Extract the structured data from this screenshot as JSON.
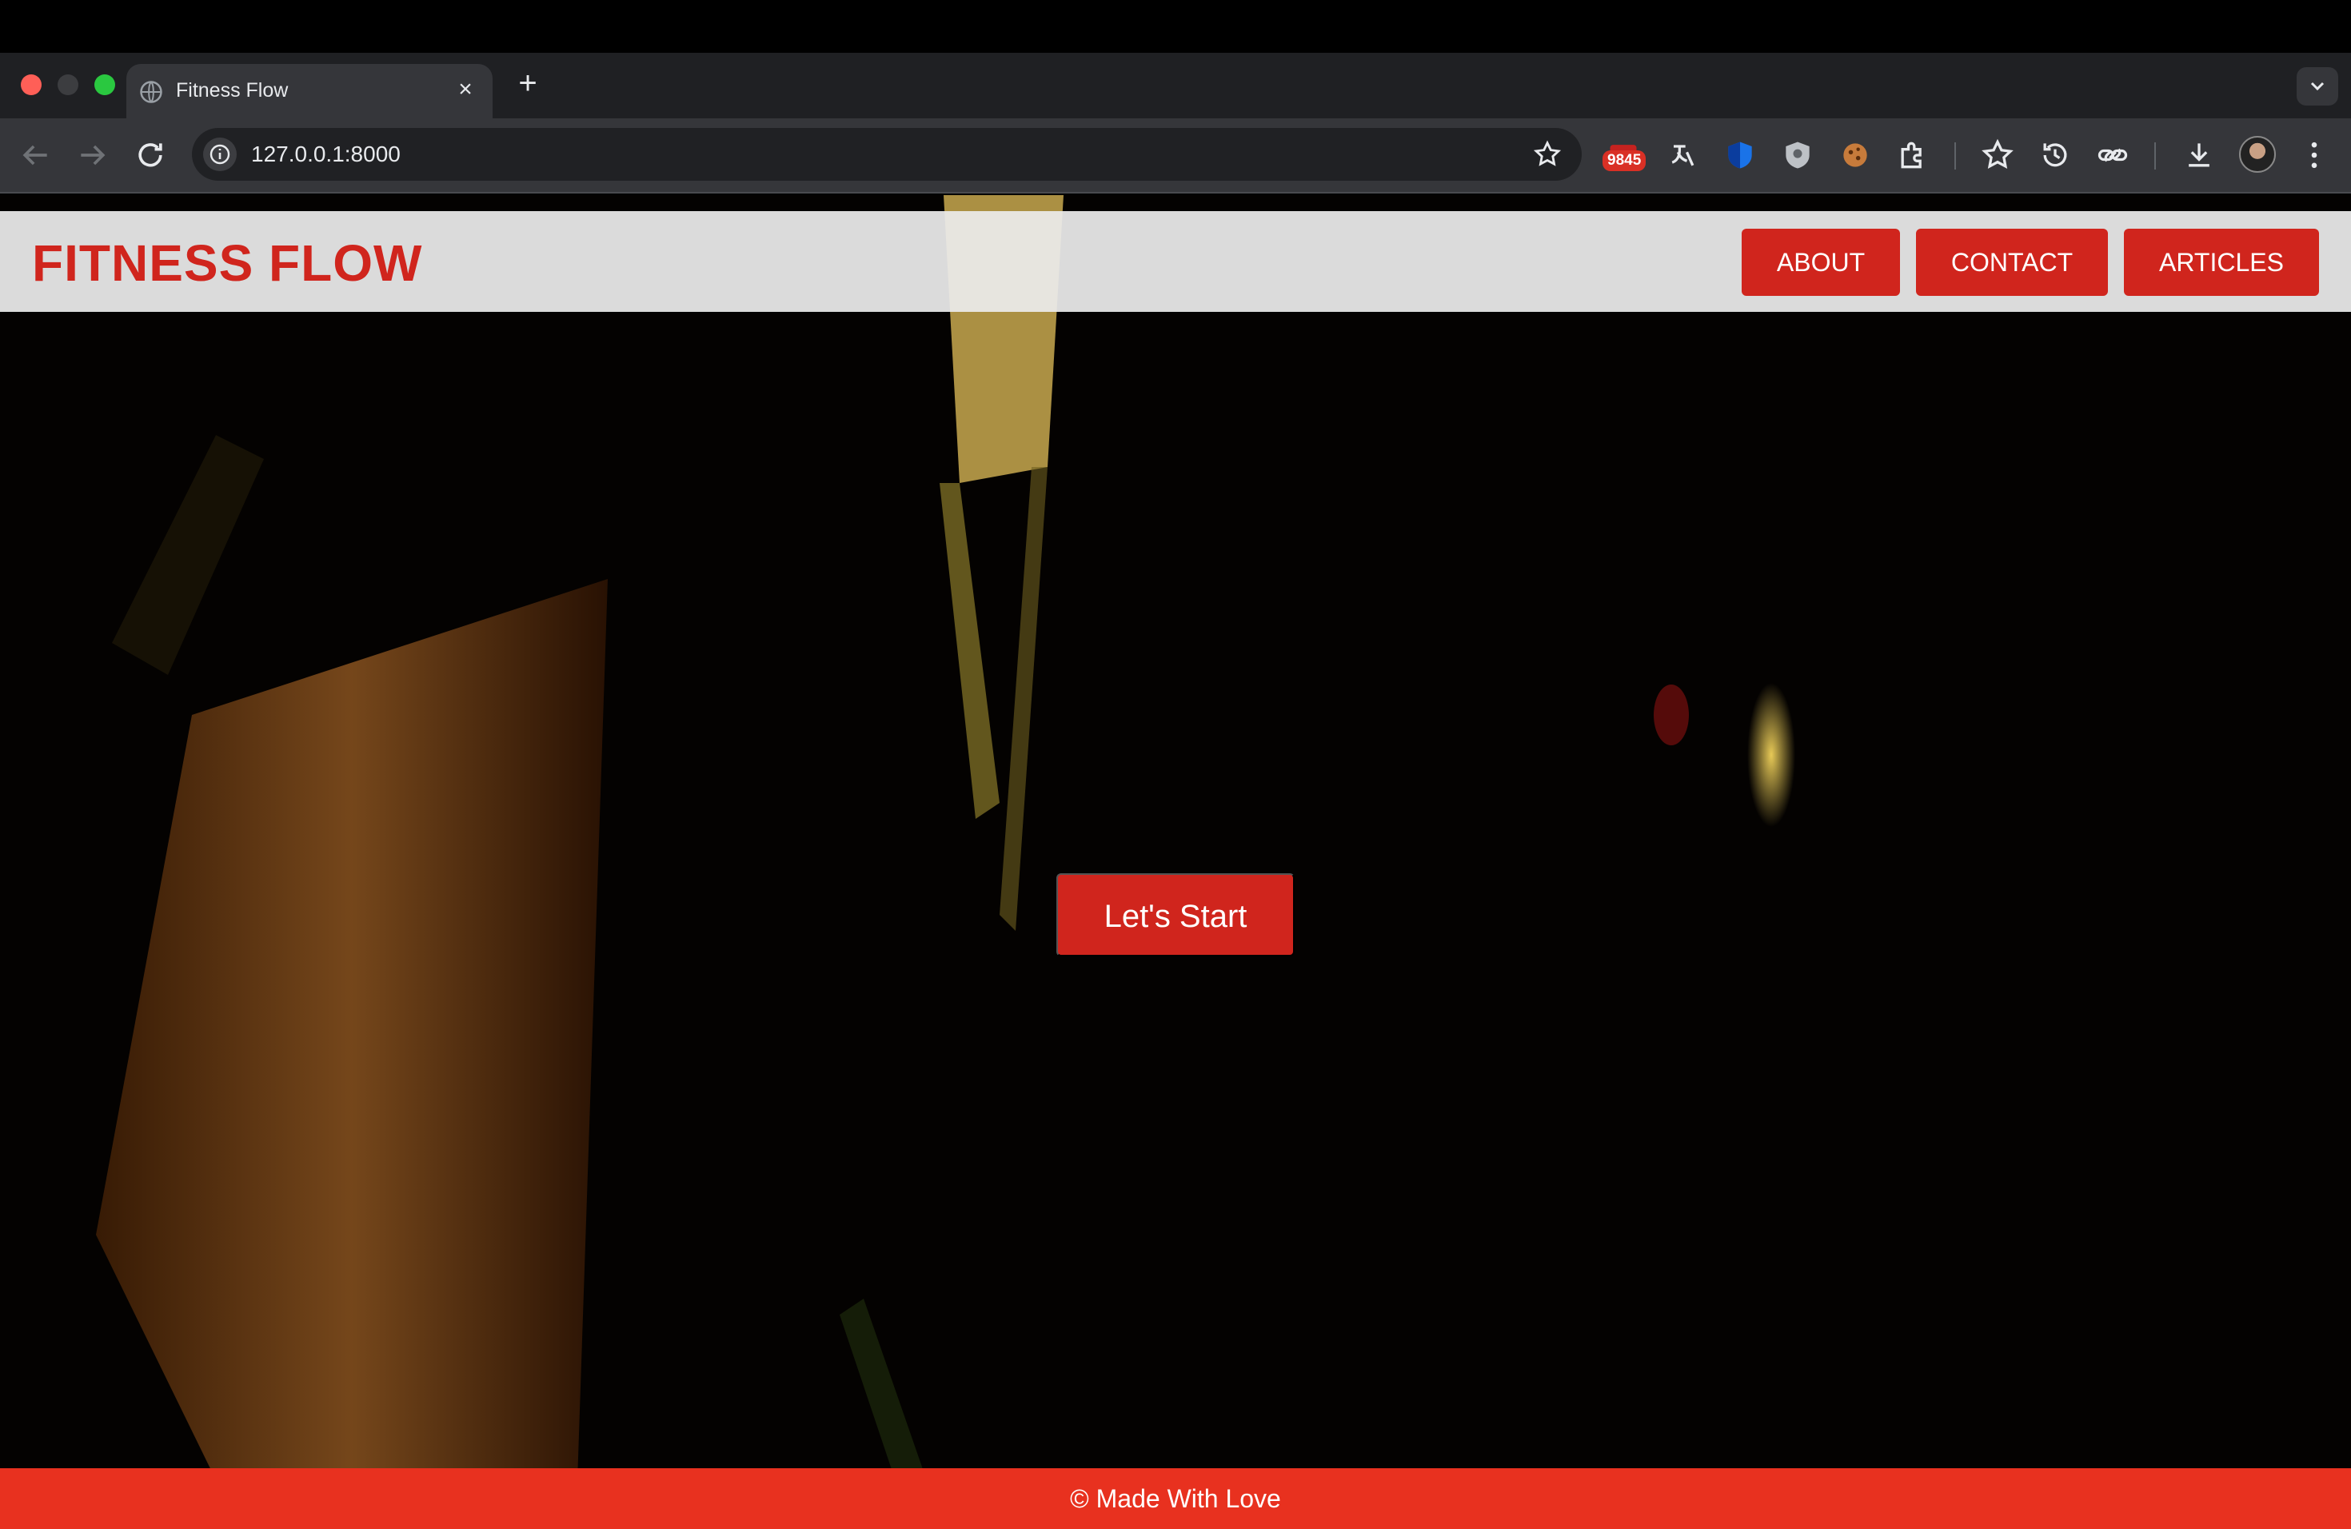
{
  "browser": {
    "tab_title": "Fitness Flow",
    "tab_close": "×",
    "new_tab": "+",
    "url": "127.0.0.1:8000",
    "extension_badge": "9845"
  },
  "site": {
    "brand": "FITNESS FLOW",
    "nav": [
      "ABOUT",
      "CONTACT",
      "ARTICLES"
    ],
    "cta": "Let's Start",
    "footer": "© Made With Love"
  },
  "colors": {
    "accent": "#d0251d",
    "footer": "#e8311f",
    "header_bg": "#ececec",
    "chrome_dark": "#1f2023",
    "chrome_toolbar": "#35363a"
  }
}
